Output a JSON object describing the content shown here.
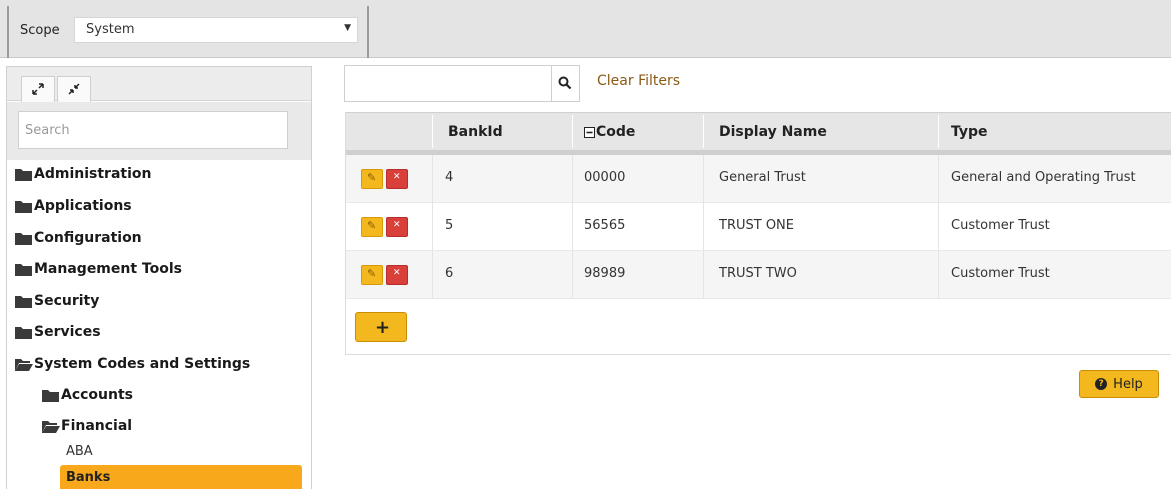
{
  "scope": {
    "label": "Scope",
    "value": "System"
  },
  "left_panel": {
    "search_placeholder": "Search",
    "tree": [
      {
        "label": "Administration",
        "open": false
      },
      {
        "label": "Applications",
        "open": false
      },
      {
        "label": "Configuration",
        "open": false
      },
      {
        "label": "Management Tools",
        "open": false
      },
      {
        "label": "Security",
        "open": false
      },
      {
        "label": "Services",
        "open": false
      },
      {
        "label": "System Codes and Settings",
        "open": true
      }
    ],
    "subtree": [
      {
        "label": "Accounts",
        "open": false
      },
      {
        "label": "Financial",
        "open": true
      }
    ],
    "leaves": [
      "ABA",
      "Banks"
    ]
  },
  "filter": {
    "clear_label": "Clear Filters"
  },
  "grid": {
    "columns": [
      "BankId",
      "Code",
      "Display Name",
      "Type"
    ],
    "rows": [
      {
        "bankid": "4",
        "code": "00000",
        "display_name": "General Trust",
        "type": "General and Operating Trust"
      },
      {
        "bankid": "5",
        "code": "56565",
        "display_name": "TRUST ONE",
        "type": "Customer Trust"
      },
      {
        "bankid": "6",
        "code": "98989",
        "display_name": "TRUST TWO",
        "type": "Customer Trust"
      }
    ]
  },
  "help": {
    "label": "Help"
  },
  "colors": {
    "accent": "#f7a81b",
    "button": "#f2b81e",
    "delete": "#d9403a",
    "folder": "#3a3a3a",
    "link": "#8a5a14"
  }
}
